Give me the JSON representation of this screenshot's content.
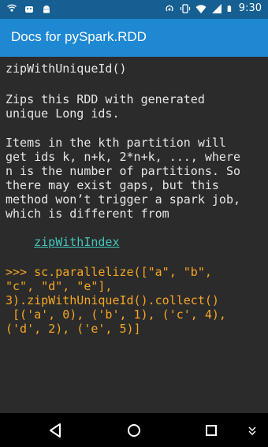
{
  "status_bar": {
    "time": "9:30",
    "left_icons": [
      "wifi-signal-icon",
      "android-debug-icon",
      "android-robot-icon"
    ],
    "right_icons": [
      "hotspot-icon",
      "vibrate-icon",
      "wifi-icon",
      "cell-signal-icon",
      "battery-icon"
    ]
  },
  "app_bar": {
    "title": "Docs for pySpark.RDD"
  },
  "doc": {
    "signature": "zipWithUniqueId()",
    "summary_line1": "Zips this RDD with generated",
    "summary_line2": "unique Long ids.",
    "details_line1": "Items in the kth partition will",
    "details_line2": "get ids k, n+k, 2*n+k, ..., where",
    "details_line3": "n is the number of partitions. So",
    "details_line4": "there may exist gaps, but this",
    "details_line5": "method won’t trigger a spark job,",
    "details_line6": "which is different from",
    "link_text": "zipWithIndex",
    "code_line1": ">>> sc.parallelize([\"a\", \"b\",",
    "code_line2": "\"c\", \"d\", \"e\"],",
    "code_line3": "3).zipWithUniqueId().collect()",
    "code_line4": " [('a', 0), ('b', 1), ('c', 4),",
    "code_line5": "('d', 2), ('e', 5)]"
  },
  "nav_bar": {
    "buttons": [
      "back-icon",
      "home-icon",
      "recents-icon"
    ],
    "extra": "keyboard-hide-icon"
  },
  "colors": {
    "status_bar": "#155f92",
    "app_bar": "#1e88d2",
    "background": "#2b2b2b",
    "link": "#43c6b8",
    "code": "#f5a623"
  }
}
